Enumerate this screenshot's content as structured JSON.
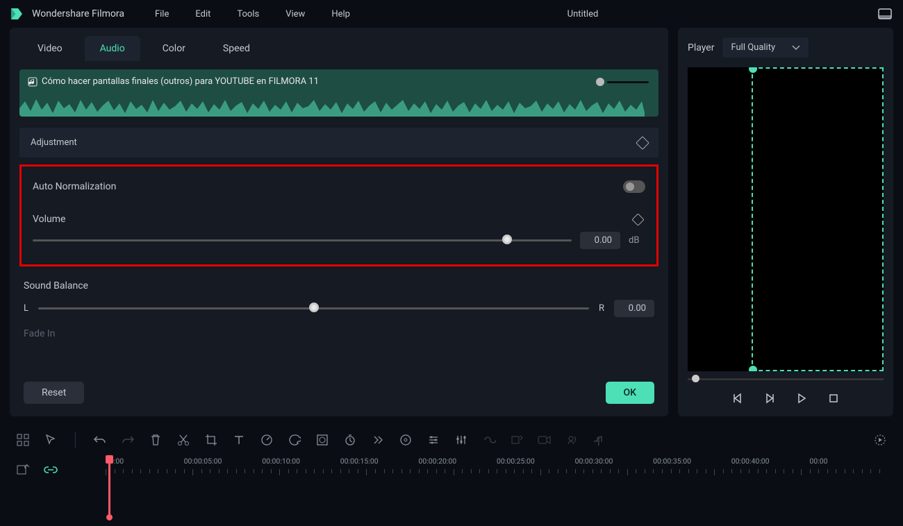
{
  "app": {
    "name": "Wondershare Filmora"
  },
  "menu": {
    "file": "File",
    "edit": "Edit",
    "tools": "Tools",
    "view": "View",
    "help": "Help"
  },
  "project": {
    "title": "Untitled"
  },
  "tabs": {
    "video": "Video",
    "audio": "Audio",
    "color": "Color",
    "speed": "Speed"
  },
  "clip": {
    "title": "Cómo hacer pantallas finales (outros) para YOUTUBE en FILMORA 11"
  },
  "adjustment": {
    "header": "Adjustment"
  },
  "auto_norm": {
    "label": "Auto Normalization"
  },
  "volume": {
    "label": "Volume",
    "value": "0.00",
    "unit": "dB"
  },
  "balance": {
    "label": "Sound Balance",
    "left": "L",
    "right": "R",
    "value": "0.00"
  },
  "fade": {
    "label": "Fade In"
  },
  "buttons": {
    "reset": "Reset",
    "ok": "OK"
  },
  "player": {
    "label": "Player",
    "quality": "Full Quality"
  },
  "timeline": {
    "stamps": [
      "00:00",
      "00:00:05:00",
      "00:00:10:00",
      "00:00:15:00",
      "00:00:20:00",
      "00:00:25:00",
      "00:00:30:00",
      "00:00:35:00",
      "00:00:40:00",
      "00:00"
    ]
  }
}
